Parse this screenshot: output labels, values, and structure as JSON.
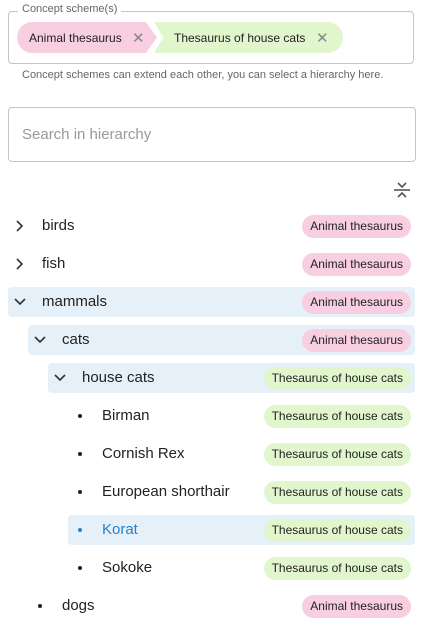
{
  "concept_schemes": {
    "legend": "Concept scheme(s)",
    "chips": [
      {
        "label": "Animal thesaurus",
        "color": "#f8cfe0"
      },
      {
        "label": "Thesaurus of house cats",
        "color": "#e2f6cd"
      }
    ],
    "remove_icon": "close-icon",
    "helper": "Concept schemes can extend each other, you can select a hierarchy here."
  },
  "search": {
    "placeholder": "Search in hierarchy",
    "value": ""
  },
  "collapse_all_icon": "collapse-vertical-icon",
  "tree": [
    {
      "label": "birds",
      "scheme": "Animal thesaurus",
      "level": 0,
      "state": "collapsed"
    },
    {
      "label": "fish",
      "scheme": "Animal thesaurus",
      "level": 0,
      "state": "collapsed"
    },
    {
      "label": "mammals",
      "scheme": "Animal thesaurus",
      "level": 0,
      "state": "expanded"
    },
    {
      "label": "cats",
      "scheme": "Animal thesaurus",
      "level": 1,
      "state": "expanded"
    },
    {
      "label": "house cats",
      "scheme": "Thesaurus of house cats",
      "level": 2,
      "state": "expanded"
    },
    {
      "label": "Birman",
      "scheme": "Thesaurus of house cats",
      "level": 3,
      "state": "leaf"
    },
    {
      "label": "Cornish Rex",
      "scheme": "Thesaurus of house cats",
      "level": 3,
      "state": "leaf"
    },
    {
      "label": "European shorthair",
      "scheme": "Thesaurus of house cats",
      "level": 3,
      "state": "leaf"
    },
    {
      "label": "Korat",
      "scheme": "Thesaurus of house cats",
      "level": 3,
      "state": "leaf",
      "selected": true
    },
    {
      "label": "Sokoke",
      "scheme": "Thesaurus of house cats",
      "level": 3,
      "state": "leaf"
    },
    {
      "label": "dogs",
      "scheme": "Animal thesaurus",
      "level": 1,
      "state": "leaf"
    }
  ],
  "colors": {
    "highlight": "#e6f0f8",
    "selected_text": "#2a82c6",
    "pink": "#f8cfe0",
    "green": "#e2f6cd"
  }
}
